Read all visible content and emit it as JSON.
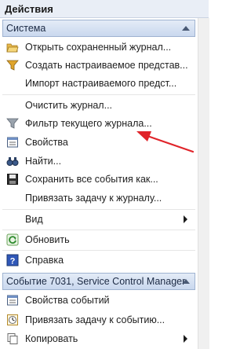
{
  "header": {
    "title": "Действия"
  },
  "section1": {
    "title": "Система",
    "items": [
      {
        "label": "Открыть сохраненный журнал...",
        "icon": "folder-open-icon"
      },
      {
        "label": "Создать настраиваемое представ...",
        "icon": "filter-icon"
      },
      {
        "label": "Импорт настраиваемого предст...",
        "icon": ""
      },
      {
        "label": "Очистить журнал...",
        "icon": ""
      },
      {
        "label": "Фильтр текущего журнала...",
        "icon": "filter-icon"
      },
      {
        "label": "Свойства",
        "icon": "properties-icon"
      },
      {
        "label": "Найти...",
        "icon": "binoculars-icon"
      },
      {
        "label": "Сохранить все события как...",
        "icon": "save-icon"
      },
      {
        "label": "Привязать задачу к журналу...",
        "icon": ""
      },
      {
        "label": "Вид",
        "icon": ""
      },
      {
        "label": "Обновить",
        "icon": "refresh-icon"
      },
      {
        "label": "Справка",
        "icon": "help-icon"
      }
    ]
  },
  "section2": {
    "title": "Событие 7031, Service Control Manager",
    "items": [
      {
        "label": "Свойства событий",
        "icon": "event-properties-icon"
      },
      {
        "label": "Привязать задачу к событию...",
        "icon": "task-icon"
      },
      {
        "label": "Копировать",
        "icon": "copy-icon"
      }
    ]
  },
  "colors": {
    "annotation_arrow": "#e0242a",
    "section_header": "#c9d8ee"
  }
}
